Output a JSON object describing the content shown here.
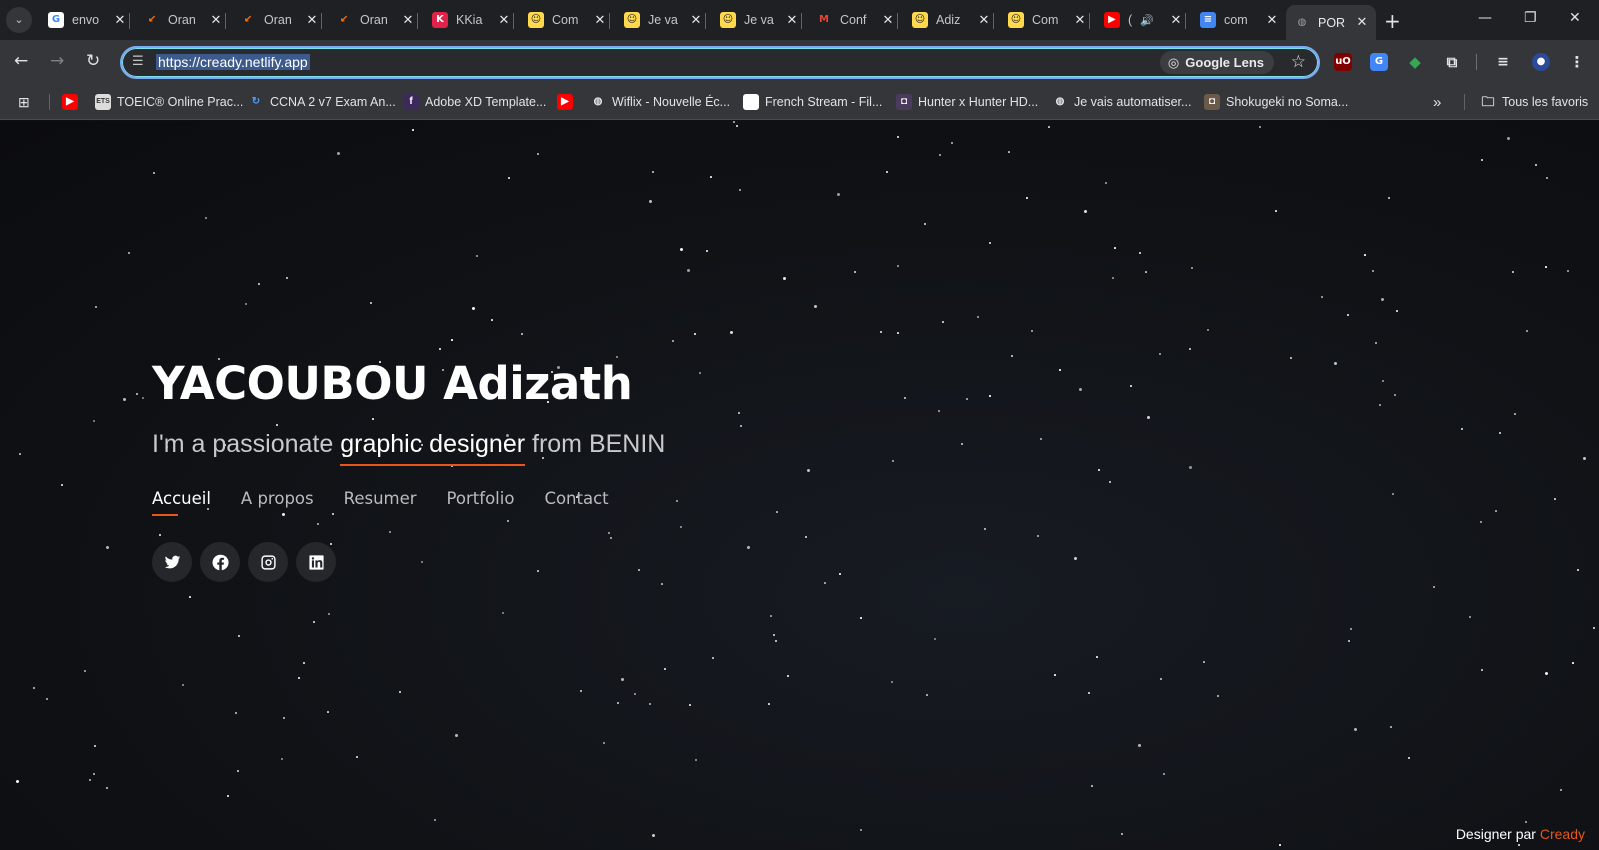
{
  "browser": {
    "tabs": [
      {
        "title": "envo",
        "favicon": "google-icon",
        "color": "#4285f4"
      },
      {
        "title": "Oran",
        "favicon": "orange-arrow-icon",
        "color": "#ff7900"
      },
      {
        "title": "Oran",
        "favicon": "orange-arrow-icon",
        "color": "#ff7900"
      },
      {
        "title": "Oran",
        "favicon": "orange-arrow-icon",
        "color": "#ff7900"
      },
      {
        "title": "KKia",
        "favicon": "kkiapay-icon",
        "color": "#e1224a"
      },
      {
        "title": "Com",
        "favicon": "comeup-icon",
        "color": "#ffd84d"
      },
      {
        "title": "Je va",
        "favicon": "comeup-icon",
        "color": "#ffd84d"
      },
      {
        "title": "Je va",
        "favicon": "comeup-icon",
        "color": "#ffd84d"
      },
      {
        "title": "Conf",
        "favicon": "gmail-icon",
        "color": "#ea4335"
      },
      {
        "title": "Adiz",
        "favicon": "comeup-icon",
        "color": "#ffd84d"
      },
      {
        "title": "Com",
        "favicon": "comeup-icon",
        "color": "#ffd84d"
      },
      {
        "title": "(",
        "favicon": "youtube-icon",
        "color": "#ff0000"
      },
      {
        "title": "com",
        "favicon": "docs-icon",
        "color": "#4285f4"
      },
      {
        "title": "POR",
        "favicon": "globe-icon",
        "color": "#9aa0a6"
      }
    ],
    "url": "https://cready.netlify.app",
    "lens_label": "Google Lens",
    "bookmarks": [
      {
        "label": "",
        "icon": "youtube-icon"
      },
      {
        "label": "TOEIC® Online Prac...",
        "icon": "toeic-icon"
      },
      {
        "label": "CCNA 2 v7 Exam An...",
        "icon": "ccna-icon"
      },
      {
        "label": "Adobe XD Template...",
        "icon": "facebook-icon"
      },
      {
        "label": "",
        "icon": "youtube-icon"
      },
      {
        "label": "Wiflix - Nouvelle Éc...",
        "icon": "globe-icon"
      },
      {
        "label": "French Stream - Fil...",
        "icon": "blank-page-icon"
      },
      {
        "label": "Hunter x Hunter HD...",
        "icon": "anime-icon"
      },
      {
        "label": "Je vais automatiser...",
        "icon": "globe-icon"
      },
      {
        "label": "Shokugeki no Soma...",
        "icon": "anime-icon"
      }
    ],
    "all_bookmarks_label": "Tous les favoris"
  },
  "hero": {
    "name": "YACOUBOU Adizath",
    "tagline_prefix": "I'm a passionate ",
    "tagline_highlight": "graphic designer",
    "tagline_suffix": " from BENIN",
    "accent_color": "#e8561b"
  },
  "nav": [
    {
      "label": "Accueil",
      "active": true
    },
    {
      "label": "A propos",
      "active": false
    },
    {
      "label": "Resumer",
      "active": false
    },
    {
      "label": "Portfolio",
      "active": false
    },
    {
      "label": "Contact",
      "active": false
    }
  ],
  "socials": [
    "twitter-icon",
    "facebook-icon",
    "instagram-icon",
    "linkedin-icon"
  ],
  "credit": {
    "prefix": "Designer par ",
    "brand": "Cready"
  }
}
